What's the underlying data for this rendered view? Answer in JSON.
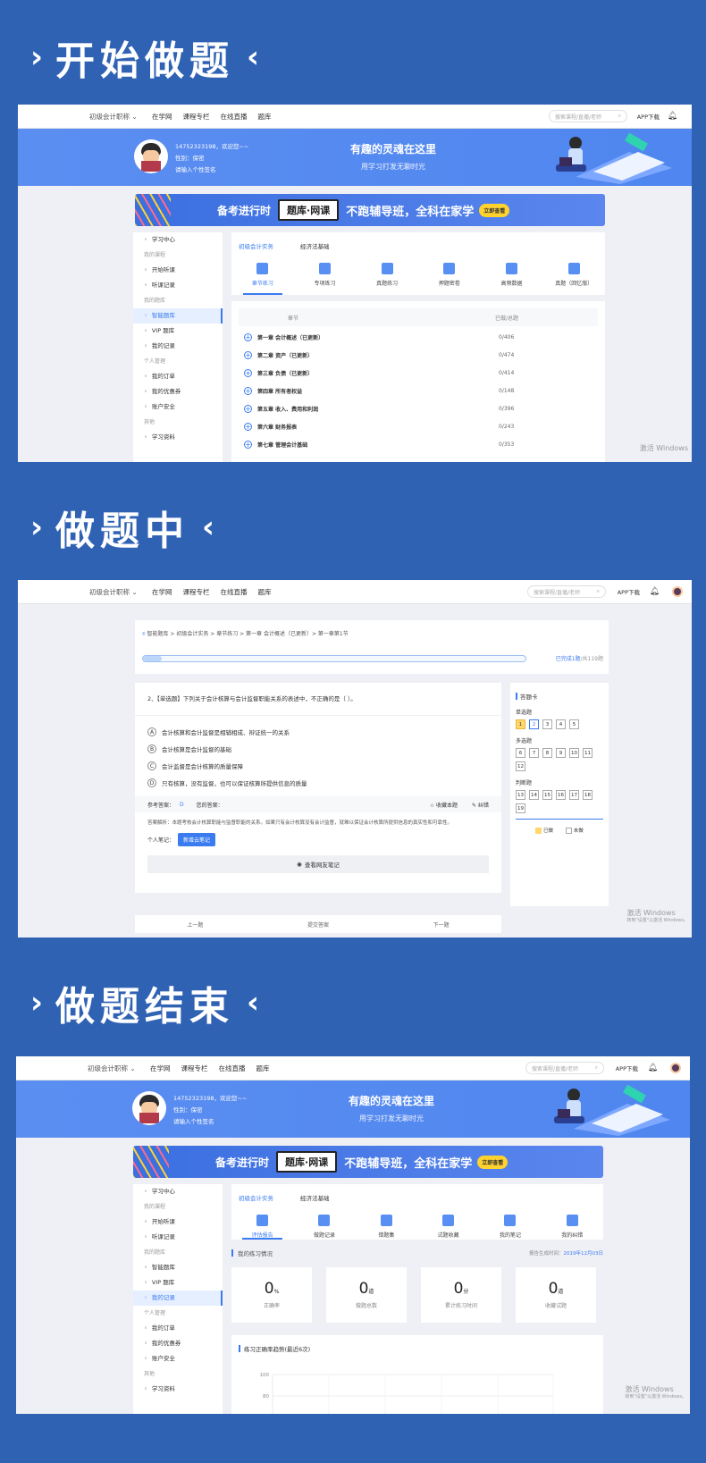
{
  "sections": [
    {
      "title": "开始做题"
    },
    {
      "title": "做题中"
    },
    {
      "title": "做题结束"
    }
  ],
  "arrow_left": "›",
  "arrow_right": "‹",
  "nav": {
    "brand": "初级会计职称 ⌄",
    "links": [
      "在学网",
      "课程专栏",
      "在线直播",
      "题库"
    ],
    "search_placeholder": "搜索课程/直播/老师",
    "app": "APP下载"
  },
  "user": {
    "phone": "14752323198，欢迎您~~",
    "gender": "性别：保密",
    "signature": "请输入个性签名"
  },
  "banner": {
    "line1": "有趣的灵魂在这里",
    "line2": "用学习打发无聊时光"
  },
  "ad": {
    "t1": "备考进行时",
    "box": "题库·网课",
    "t2": "不跑辅导班，全科在家学",
    "go": "立即查看"
  },
  "sidebar1": [
    {
      "t": "item",
      "label": "学习中心"
    },
    {
      "t": "grp",
      "label": "我的课程"
    },
    {
      "t": "item",
      "label": "开始听课"
    },
    {
      "t": "item",
      "label": "听课记录"
    },
    {
      "t": "grp",
      "label": "我的题库"
    },
    {
      "t": "item",
      "label": "智能题库",
      "active": true
    },
    {
      "t": "item",
      "label": "VIP 题库"
    },
    {
      "t": "item",
      "label": "我的记录"
    },
    {
      "t": "grp",
      "label": "个人管理"
    },
    {
      "t": "item",
      "label": "我的订单"
    },
    {
      "t": "item",
      "label": "我的优惠券"
    },
    {
      "t": "item",
      "label": "账户安全"
    },
    {
      "t": "grp",
      "label": "其他"
    },
    {
      "t": "item",
      "label": "学习资料"
    }
  ],
  "sidebar3": [
    {
      "t": "item",
      "label": "学习中心"
    },
    {
      "t": "grp",
      "label": "我的课程"
    },
    {
      "t": "item",
      "label": "开始听课"
    },
    {
      "t": "item",
      "label": "听课记录"
    },
    {
      "t": "grp",
      "label": "我的题库"
    },
    {
      "t": "item",
      "label": "智能题库"
    },
    {
      "t": "item",
      "label": "VIP 题库"
    },
    {
      "t": "item",
      "label": "我的记录",
      "active": true
    },
    {
      "t": "grp",
      "label": "个人管理"
    },
    {
      "t": "item",
      "label": "我的订单"
    },
    {
      "t": "item",
      "label": "我的优惠券"
    },
    {
      "t": "item",
      "label": "账户安全"
    },
    {
      "t": "grp",
      "label": "其他"
    },
    {
      "t": "item",
      "label": "学习资料"
    }
  ],
  "subjects": [
    "初级会计实务",
    "经济法基础"
  ],
  "modes1": [
    "章节练习",
    "专项练习",
    "真题练习",
    "押题密卷",
    "高频数据",
    "真题（回忆版）"
  ],
  "chapter_head": {
    "name": "章节",
    "count": "已做/总题"
  },
  "chapters": [
    {
      "name": "第一章 会计概述（已更新）",
      "count": "0/406"
    },
    {
      "name": "第二章 资产（已更新）",
      "count": "0/474"
    },
    {
      "name": "第三章 负债（已更新）",
      "count": "0/414"
    },
    {
      "name": "第四章 所有者权益",
      "count": "0/148"
    },
    {
      "name": "第五章 收入、费用和利润",
      "count": "0/396"
    },
    {
      "name": "第六章 财务报表",
      "count": "0/243"
    },
    {
      "name": "第七章 管理会计基础",
      "count": "0/353"
    }
  ],
  "watermark": {
    "a": "激活 Windows",
    "b": "转到\"设置\"以激活 Windows。"
  },
  "quiz": {
    "crumb": "智能题库 > 初级会计实务 > 章节练习 > 第一章 会计概述（已更新）> 第一章第1节",
    "progress": 0.05,
    "progress_text": "已完成1题",
    "total_text": "共119题",
    "question": "2、【单选题】下列关于会计核算与会计监督职能关系的表述中，不正确的是（ ）。",
    "options": [
      {
        "k": "A",
        "t": "会计核算和会计监督是相辅相成、辩证统一的关系"
      },
      {
        "k": "B",
        "t": "会计核算是会计监督的基础"
      },
      {
        "k": "C",
        "t": "会计监督是会计核算的质量保障"
      },
      {
        "k": "D",
        "t": "只有核算，没有监督，也可以保证核算所提供信息的质量"
      }
    ],
    "ref_label": "参考答案：",
    "ref_answer": "D",
    "your_label": "您的答案：",
    "collect": "收藏本题",
    "report": "纠错",
    "analysis": "答案解析：本题考核会计核算职能与监督职能的关系。如果只有会计核算没有会计监督，就难以保证会计核算所提供信息的真实性和可靠性。",
    "note_label": "个人笔记：",
    "note_btn": "新增云笔记",
    "friend_notes": "查看网友笔记",
    "prev": "上一题",
    "submit": "提交答案",
    "next": "下一题"
  },
  "answer_card": {
    "title": "答题卡",
    "groups": [
      {
        "label": "单选题",
        "nums": [
          "1",
          "2",
          "3",
          "4",
          "5"
        ]
      },
      {
        "label": "多选题",
        "nums": [
          "6",
          "7",
          "8",
          "9",
          "10",
          "11",
          "12"
        ]
      },
      {
        "label": "判断题",
        "nums": [
          "13",
          "14",
          "15",
          "16",
          "17",
          "18",
          "19"
        ]
      }
    ],
    "done": "已做",
    "todo": "未做"
  },
  "modes3": [
    "评估报告",
    "做题记录",
    "错题集",
    "试题收藏",
    "我的笔记",
    "我的纠错"
  ],
  "report": {
    "title": "我的练习情况",
    "gen_label": "报告生成时间：",
    "gen_date": "2019年12月03日",
    "stats": [
      {
        "v": "0",
        "u": "%",
        "l": "正确率"
      },
      {
        "v": "0",
        "u": "道",
        "l": "做题总数"
      },
      {
        "v": "0",
        "u": "分",
        "l": "累计练习时间"
      },
      {
        "v": "0",
        "u": "道",
        "l": "收藏试题"
      }
    ],
    "trend_title": "练习正确率趋势(最近6次)",
    "y_ticks": [
      "100",
      "80"
    ]
  }
}
